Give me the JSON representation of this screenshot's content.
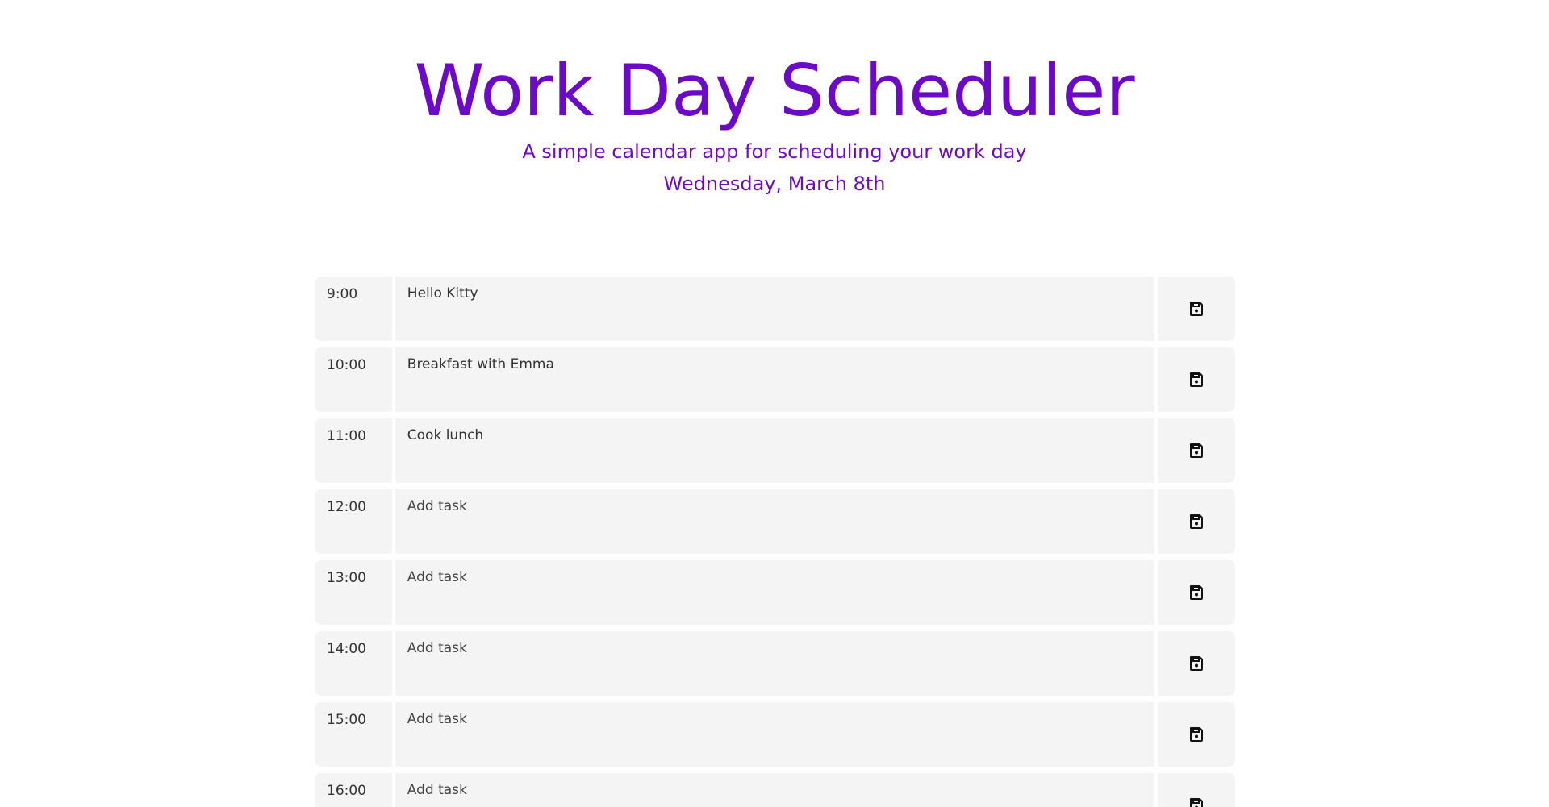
{
  "header": {
    "title": "Work Day Scheduler",
    "subtitle": "A simple calendar app for scheduling your work day",
    "current_date": "Wednesday, March 8th"
  },
  "colors": {
    "accent": "#6c0ac7",
    "row_background": "#f4f4f4"
  },
  "schedule": {
    "task_placeholder": "Add task",
    "save_icon": "floppy-disk-icon",
    "rows": [
      {
        "hour": "9:00",
        "task": "Hello Kitty"
      },
      {
        "hour": "10:00",
        "task": "Breakfast with Emma\n"
      },
      {
        "hour": "11:00",
        "task": "Cook lunch"
      },
      {
        "hour": "12:00",
        "task": ""
      },
      {
        "hour": "13:00",
        "task": ""
      },
      {
        "hour": "14:00",
        "task": ""
      },
      {
        "hour": "15:00",
        "task": ""
      },
      {
        "hour": "16:00",
        "task": ""
      }
    ]
  }
}
